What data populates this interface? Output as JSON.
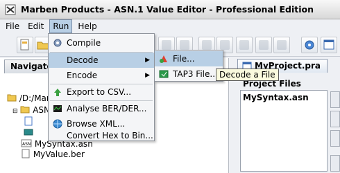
{
  "window": {
    "title": "Marben Products - ASN.1 Value Editor - Professional Edition"
  },
  "menubar": {
    "file": {
      "label": "File"
    },
    "edit": {
      "label": "Edit"
    },
    "run": {
      "label": "Run"
    },
    "help": {
      "label": "Help"
    }
  },
  "navigator": {
    "tab_label": "Navigato",
    "tree": [
      {
        "label": "/D:/Marb"
      },
      {
        "label": "ASN"
      },
      {
        "label": "MySyntax.asn"
      },
      {
        "label": "MyValue.ber"
      }
    ]
  },
  "run_menu": {
    "items": [
      {
        "label": "Compile"
      },
      {
        "label": "Decode"
      },
      {
        "label": "Encode"
      },
      {
        "label": "Export to CSV..."
      },
      {
        "label": "Analyse BER/DER..."
      },
      {
        "label": "Browse XML..."
      },
      {
        "label": "Convert Hex to Bin..."
      }
    ]
  },
  "decode_submenu": {
    "items": [
      {
        "label": "File..."
      },
      {
        "label": "TAP3 File..."
      }
    ]
  },
  "tooltip": {
    "text": "Decode a File"
  },
  "project": {
    "tab_label": "MyProject.pra",
    "files_label": "Project Files",
    "files": [
      {
        "label": "MySyntax.asn"
      }
    ]
  },
  "colors": {
    "highlight": "#b8cfe5",
    "tooltip_bg": "#fafade"
  }
}
